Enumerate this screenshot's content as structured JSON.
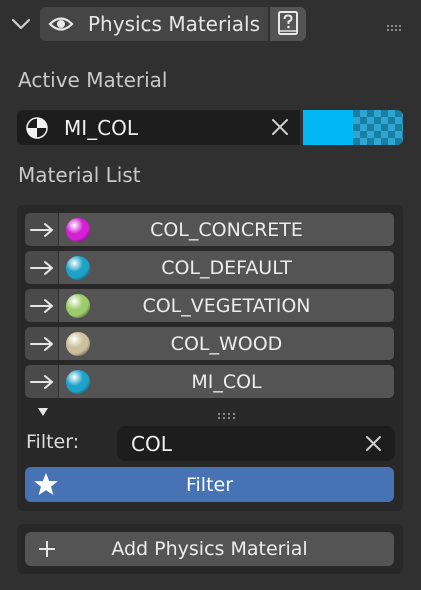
{
  "header": {
    "title": "Physics Materials",
    "collapse_icon": "chevron-down-icon",
    "visibility_icon": "eye-icon",
    "help_icon": "help-book-icon",
    "drag_icon": "grip-dots-icon"
  },
  "active_material": {
    "label": "Active Material",
    "name": "MI_COL",
    "icon": "material-shader-icon",
    "clear_icon": "close-icon",
    "color": "#00b7f4"
  },
  "material_list": {
    "label": "Material List",
    "items": [
      {
        "name": "COL_CONCRETE",
        "color": "#d41fd4"
      },
      {
        "name": "COL_DEFAULT",
        "color": "#1ea3c8"
      },
      {
        "name": "COL_VEGETATION",
        "color": "#9ccc6a"
      },
      {
        "name": "COL_WOOD",
        "color": "#cdbf9c"
      },
      {
        "name": "MI_COL",
        "color": "#1ea3c8"
      }
    ],
    "row_icon": "arrow-right-icon",
    "filter": {
      "label": "Filter:",
      "value": "COL",
      "clear_icon": "close-icon"
    },
    "filter_button": {
      "label": "Filter",
      "icon": "star-icon",
      "color": "#4772b3"
    }
  },
  "add_button": {
    "label": "Add Physics Material",
    "icon": "plus-icon"
  }
}
